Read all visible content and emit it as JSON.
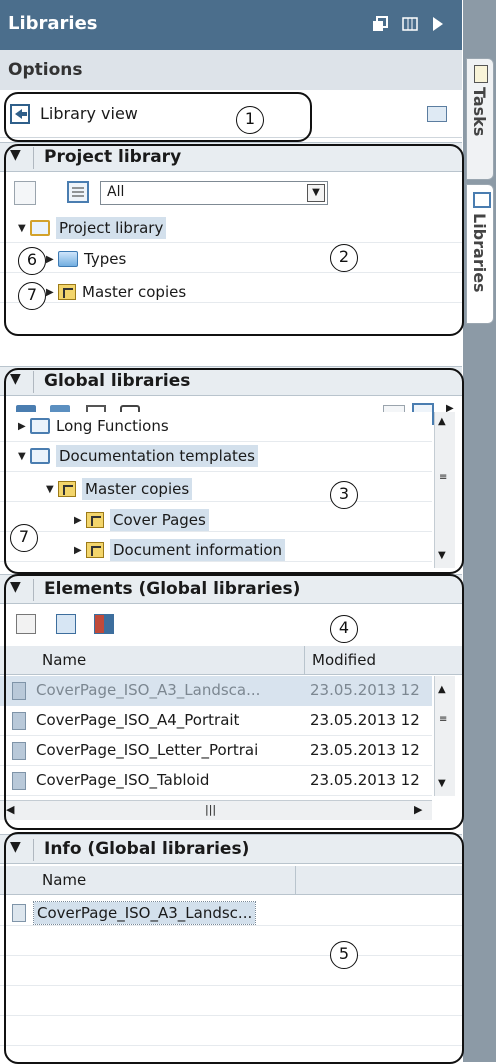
{
  "header": {
    "title": "Libraries"
  },
  "options": {
    "label": "Options"
  },
  "library_view": {
    "label": "Library view"
  },
  "callouts": [
    "1",
    "2",
    "3",
    "4",
    "5",
    "6",
    "7"
  ],
  "project_library": {
    "header": "Project library",
    "filter_value": "All",
    "tree": {
      "root": "Project library",
      "types": "Types",
      "master_copies": "Master copies"
    }
  },
  "global_libraries": {
    "header": "Global libraries",
    "tree": {
      "long_functions": "Long Functions",
      "doc_templates": "Documentation templates",
      "master_copies": "Master copies",
      "cover_pages": "Cover Pages",
      "document_information": "Document information"
    }
  },
  "elements": {
    "header": "Elements (Global libraries)",
    "columns": {
      "name": "Name",
      "modified": "Modified"
    },
    "rows": [
      {
        "name": "CoverPage_ISO_A3_Landsca...",
        "modified": "23.05.2013 12"
      },
      {
        "name": "CoverPage_ISO_A4_Portrait",
        "modified": "23.05.2013 12"
      },
      {
        "name": "CoverPage_ISO_Letter_Portrai",
        "modified": "23.05.2013 12"
      },
      {
        "name": "CoverPage_ISO_Tabloid",
        "modified": "23.05.2013 12"
      }
    ]
  },
  "info": {
    "header": "Info (Global libraries)",
    "column_name": "Name",
    "item": "CoverPage_ISO_A3_Landsc..."
  },
  "side_tabs": {
    "tasks": "Tasks",
    "libraries": "Libraries"
  },
  "colors": {
    "title_bg": "#4b6e8c",
    "accent": "#4a7db0",
    "selected": "#d3e0ec",
    "side": "#8c9aa6"
  }
}
